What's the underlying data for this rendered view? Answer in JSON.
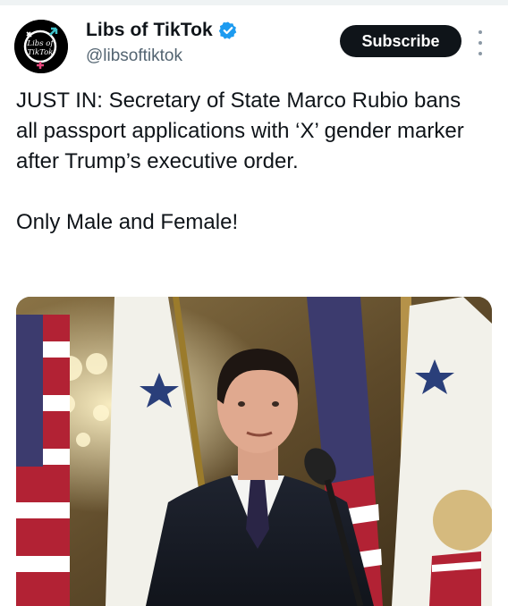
{
  "author": {
    "display_name": "Libs of TikTok",
    "handle": "@libsoftiktok",
    "verified": true,
    "avatar_text_line1": "Libs of",
    "avatar_text_line2": "TikTok"
  },
  "actions": {
    "subscribe_label": "Subscribe",
    "more_icon": "more-vertical-icon"
  },
  "tweet": {
    "paragraph1": "JUST IN: Secretary of State Marco Rubio bans all passport applications with ‘X’ gender marker after Trump’s executive order.",
    "paragraph2": "Only Male and Female!"
  },
  "colors": {
    "verified_blue": "#1d9bf0",
    "subscribe_bg": "#0f1419",
    "handle_gray": "#536471",
    "avatar_pink": "#e8467c",
    "avatar_teal": "#3fc1c9"
  }
}
